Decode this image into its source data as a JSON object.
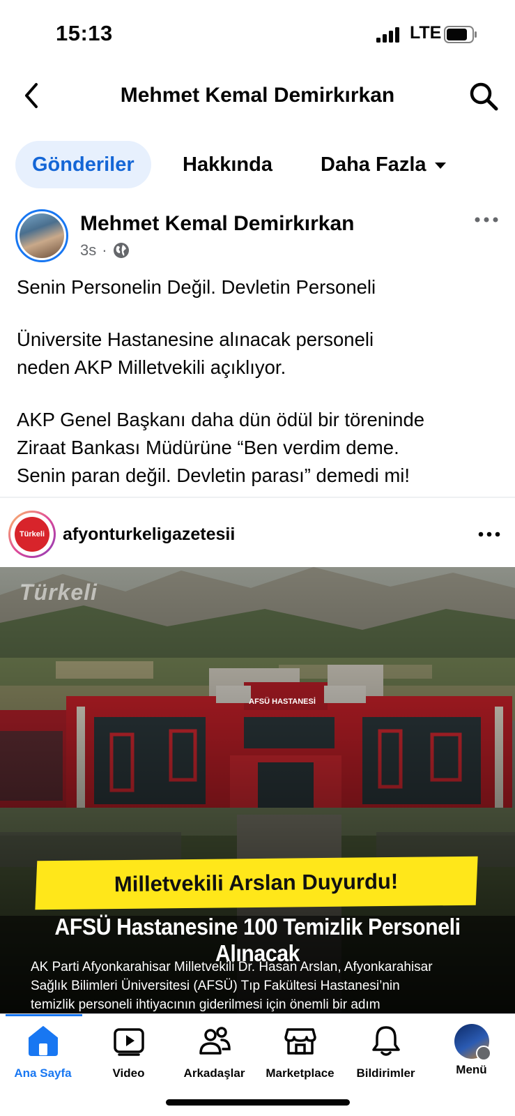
{
  "status_bar": {
    "time": "15:13",
    "network": "LTE"
  },
  "header": {
    "title": "Mehmet Kemal Demirkırkan"
  },
  "tabs": [
    {
      "label": "Gönderiler",
      "active": true
    },
    {
      "label": "Hakkında"
    },
    {
      "label": "Daha Fazla"
    }
  ],
  "post": {
    "author": "Mehmet Kemal Demirkırkan",
    "time": "3s",
    "privacy_icon": "globe-icon",
    "text": {
      "p1": "Senin Personelin Değil. Devletin Personeli",
      "p2_l1": "Üniversite Hastanesine alınacak personeli",
      "p2_l2": "neden AKP Milletvekili açıklıyor.",
      "p3_l1": "AKP Genel Başkanı daha dün ödül bir töreninde",
      "p3_l2": "Ziraat Bankası Müdürüne  “Ben verdim deme.",
      "p3_l3": "Senin paran değil. Devletin parası” demedi mi!"
    }
  },
  "shared": {
    "account": "afyonturkeligazetesii",
    "logo_text": "Türkeli",
    "image": {
      "watermark": "Türkeli",
      "building_sign": "AFSÜ HASTANESİ",
      "banner": "Milletvekili Arslan Duyurdu!",
      "headline": "AFSÜ Hastanesine 100 Temizlik Personeli Alınacak",
      "caption_l1": "AK Parti Afyonkarahisar Milletvekili Dr. Hasan Arslan, Afyonkarahisar",
      "caption_l2": "Sağlık Bilimleri Üniversitesi (AFSÜ) Tıp Fakültesi Hastanesi’nin",
      "caption_l3": "temizlik personeli ihtiyacının giderilmesi için önemli bir adım"
    }
  },
  "bottom_nav": [
    {
      "label": "Ana Sayfa",
      "icon": "home-icon",
      "active": true
    },
    {
      "label": "Video",
      "icon": "video-icon"
    },
    {
      "label": "Arkadaşlar",
      "icon": "friends-icon"
    },
    {
      "label": "Marketplace",
      "icon": "marketplace-icon"
    },
    {
      "label": "Bildirimler",
      "icon": "bell-icon"
    },
    {
      "label": "Menü",
      "icon": "menu-avatar"
    }
  ],
  "colors": {
    "accent": "#1877f2",
    "tab_active_bg": "#e7f0fd",
    "banner": "#ffe71a",
    "hospital_red": "#d8242b"
  }
}
